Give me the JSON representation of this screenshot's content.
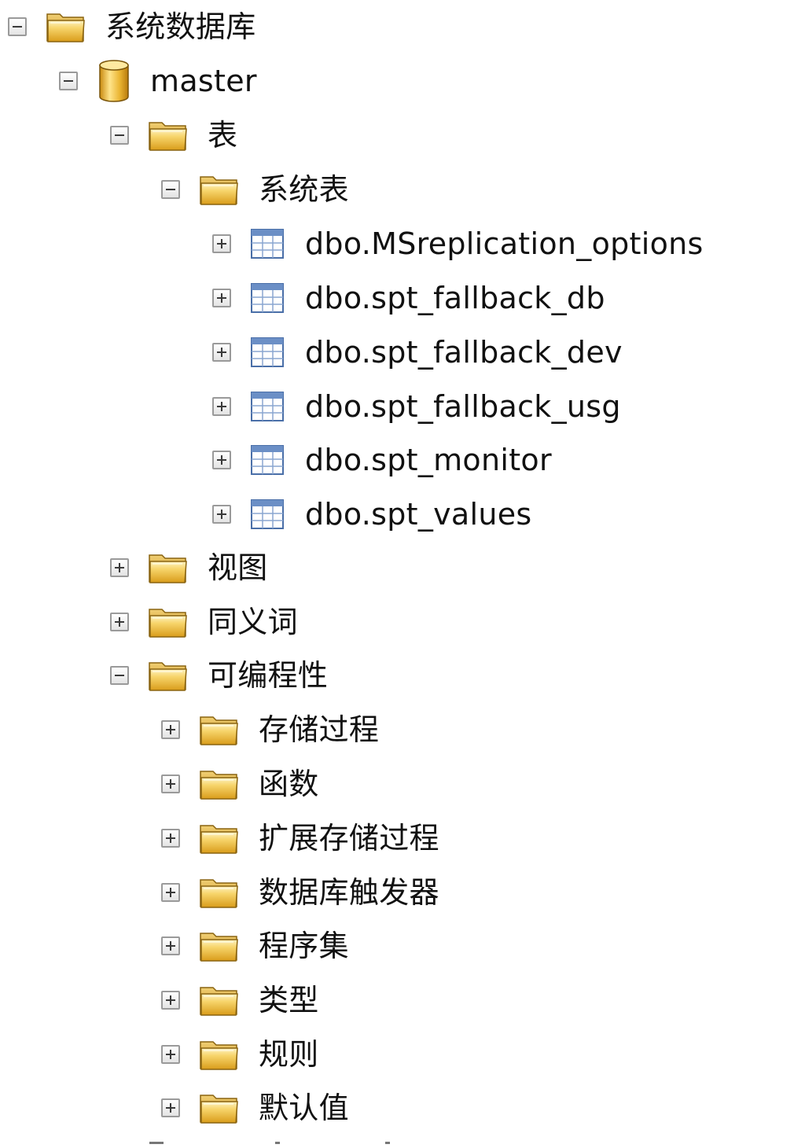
{
  "tree": {
    "system_databases": {
      "label": "系统数据库",
      "state": "expanded",
      "icon": "folder-icon"
    },
    "master": {
      "label": "master",
      "state": "expanded",
      "icon": "database-icon"
    },
    "tables": {
      "label": "表",
      "state": "expanded",
      "icon": "folder-icon"
    },
    "system_tables": {
      "label": "系统表",
      "state": "expanded",
      "icon": "folder-icon"
    },
    "table_items": [
      {
        "label": "dbo.MSreplication_options",
        "state": "collapsed",
        "icon": "table-icon"
      },
      {
        "label": "dbo.spt_fallback_db",
        "state": "collapsed",
        "icon": "table-icon"
      },
      {
        "label": "dbo.spt_fallback_dev",
        "state": "collapsed",
        "icon": "table-icon"
      },
      {
        "label": "dbo.spt_fallback_usg",
        "state": "collapsed",
        "icon": "table-icon"
      },
      {
        "label": "dbo.spt_monitor",
        "state": "collapsed",
        "icon": "table-icon"
      },
      {
        "label": "dbo.spt_values",
        "state": "collapsed",
        "icon": "table-icon"
      }
    ],
    "views": {
      "label": "视图",
      "state": "collapsed",
      "icon": "folder-icon"
    },
    "synonyms": {
      "label": "同义词",
      "state": "collapsed",
      "icon": "folder-icon"
    },
    "programmability": {
      "label": "可编程性",
      "state": "expanded",
      "icon": "folder-icon"
    },
    "programmability_items": [
      {
        "label": "存储过程",
        "state": "collapsed",
        "icon": "folder-icon"
      },
      {
        "label": "函数",
        "state": "collapsed",
        "icon": "folder-icon"
      },
      {
        "label": "扩展存储过程",
        "state": "collapsed",
        "icon": "folder-icon"
      },
      {
        "label": "数据库触发器",
        "state": "collapsed",
        "icon": "folder-icon"
      },
      {
        "label": "程序集",
        "state": "collapsed",
        "icon": "folder-icon"
      },
      {
        "label": "类型",
        "state": "collapsed",
        "icon": "folder-icon"
      },
      {
        "label": "规则",
        "state": "collapsed",
        "icon": "folder-icon"
      },
      {
        "label": "默认值",
        "state": "collapsed",
        "icon": "folder-icon"
      }
    ]
  },
  "colors": {
    "folder_front": "#f3c44a",
    "folder_back": "#e0a92a",
    "database_body": "#e8b12c",
    "table_grid": "#5b7fb3"
  }
}
